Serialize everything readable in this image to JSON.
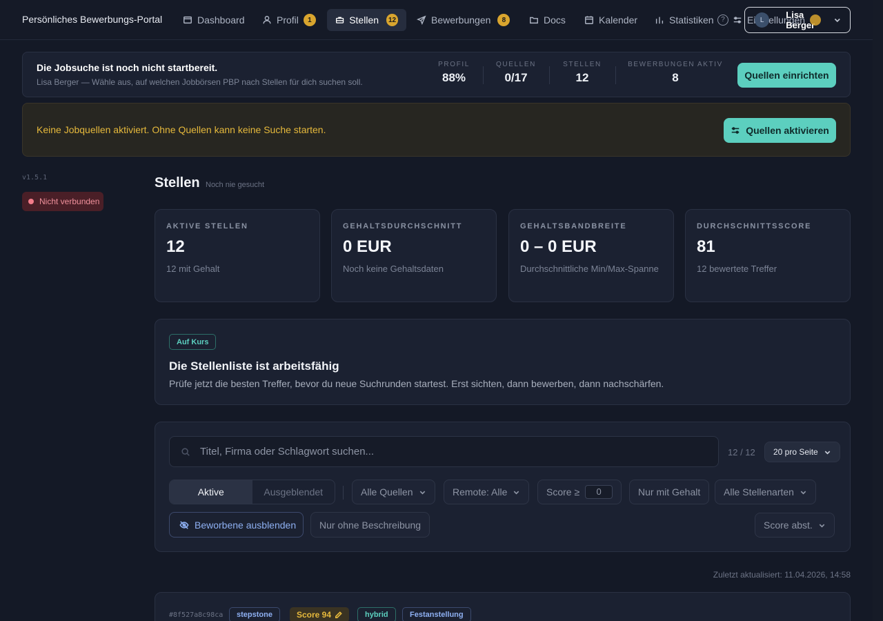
{
  "nav": {
    "brand": "Persönliches Bewerbungs-Portal",
    "items": [
      {
        "label": "Dashboard",
        "icon": "dashboard-icon"
      },
      {
        "label": "Profil",
        "icon": "user-icon",
        "badge": "1"
      },
      {
        "label": "Stellen",
        "icon": "briefcase-icon",
        "badge": "12",
        "active": true
      },
      {
        "label": "Bewerbungen",
        "icon": "send-icon",
        "badge": "8"
      },
      {
        "label": "Docs",
        "icon": "folder-icon"
      },
      {
        "label": "Kalender",
        "icon": "calendar-icon"
      },
      {
        "label": "Statistiken",
        "icon": "bar-chart-icon"
      }
    ],
    "help_glyph": "?",
    "settings_label": "Einstellungen",
    "user": {
      "name": "Lisa Berger",
      "initials": "L"
    }
  },
  "status": {
    "title": "Die Jobsuche ist noch nicht startbereit.",
    "subtitle": "Lisa Berger — Wähle aus, auf welchen Jobbörsen PBP nach Stellen für dich suchen soll.",
    "stats": [
      {
        "label": "Profil",
        "value": "88%"
      },
      {
        "label": "Quellen",
        "value": "0/17"
      },
      {
        "label": "Stellen",
        "value": "12"
      },
      {
        "label": "Bewerbungen aktiv",
        "value": "8"
      }
    ],
    "button": "Quellen einrichten"
  },
  "warning": {
    "text": "Keine Jobquellen aktiviert. Ohne Quellen kann keine Suche starten.",
    "button": "Quellen aktivieren"
  },
  "sidebar": {
    "version": "v1.5.1",
    "connection": "Nicht verbunden"
  },
  "page": {
    "title": "Stellen",
    "subtitle": "Noch nie gesucht"
  },
  "kpis": [
    {
      "label": "Aktive Stellen",
      "value": "12",
      "sub": "12 mit Gehalt"
    },
    {
      "label": "Gehaltsdurchschnitt",
      "value": "0 EUR",
      "sub": "Noch keine Gehaltsdaten"
    },
    {
      "label": "Gehaltsbandbreite",
      "value": "0 – 0 EUR",
      "sub": "Durchschnittliche Min/Max-Spanne"
    },
    {
      "label": "Durchschnittsscore",
      "value": "81",
      "sub": "12 bewertete Treffer"
    }
  ],
  "course": {
    "pill": "Auf Kurs",
    "title": "Die Stellenliste ist arbeitsfähig",
    "subtitle": "Prüfe jetzt die besten Treffer, bevor du neue Suchrunden startest. Erst sichten, dann bewerben, dann nachschärfen."
  },
  "filters": {
    "search_placeholder": "Titel, Firma oder Schlagwort suchen...",
    "count": "12 / 12",
    "per_page": "20 pro Seite",
    "segments": [
      "Aktive",
      "Ausgeblendet"
    ],
    "sources": "Alle Quellen",
    "remote": "Remote: Alle",
    "score_label": "Score ≥",
    "score_value": "0",
    "salary_only": "Nur mit Gehalt",
    "job_types": "Alle Stellenarten",
    "hide_applied": "Beworbene ausblenden",
    "no_description": "Nur ohne Beschreibung",
    "sort": "Score abst."
  },
  "updated": "Zuletzt aktualisiert: 11.04.2026, 14:58",
  "job": {
    "id": "#8f527a8c98ca",
    "source": "stepstone",
    "score": "Score 94",
    "remote": "hybrid",
    "type": "Festanstellung"
  }
}
